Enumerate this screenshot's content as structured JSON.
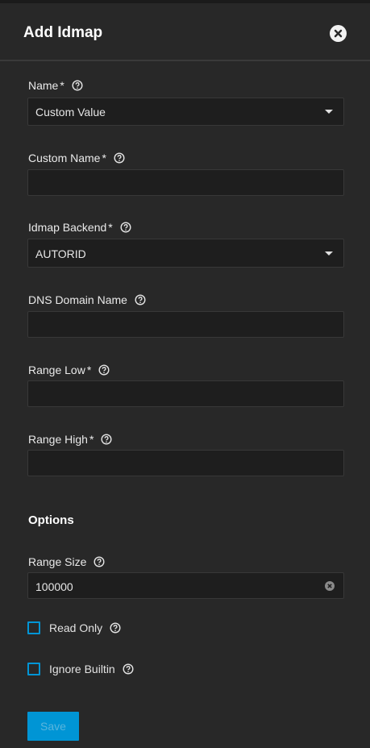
{
  "dialog": {
    "title": "Add Idmap"
  },
  "fields": {
    "name": {
      "label": "Name",
      "required_mark": "*",
      "value": "Custom Value"
    },
    "custom_name": {
      "label": "Custom Name",
      "required_mark": "*",
      "value": ""
    },
    "backend": {
      "label": "Idmap Backend",
      "required_mark": "*",
      "value": "AUTORID"
    },
    "dns_domain": {
      "label": "DNS Domain Name",
      "value": ""
    },
    "range_low": {
      "label": "Range Low",
      "required_mark": "*",
      "value": ""
    },
    "range_high": {
      "label": "Range High",
      "required_mark": "*",
      "value": ""
    }
  },
  "options": {
    "heading": "Options",
    "range_size": {
      "label": "Range Size",
      "value": "100000"
    },
    "read_only": {
      "label": "Read Only",
      "checked": false
    },
    "ignore_builtin": {
      "label": "Ignore Builtin",
      "checked": false
    }
  },
  "actions": {
    "save_label": "Save"
  },
  "colors": {
    "accent": "#0095d5",
    "background": "#282828",
    "input_bg": "#1e1e1e"
  },
  "icons": {
    "close": "close-icon",
    "help": "help-circle-icon",
    "dropdown": "chevron-down-icon",
    "clear": "clear-input-icon"
  }
}
